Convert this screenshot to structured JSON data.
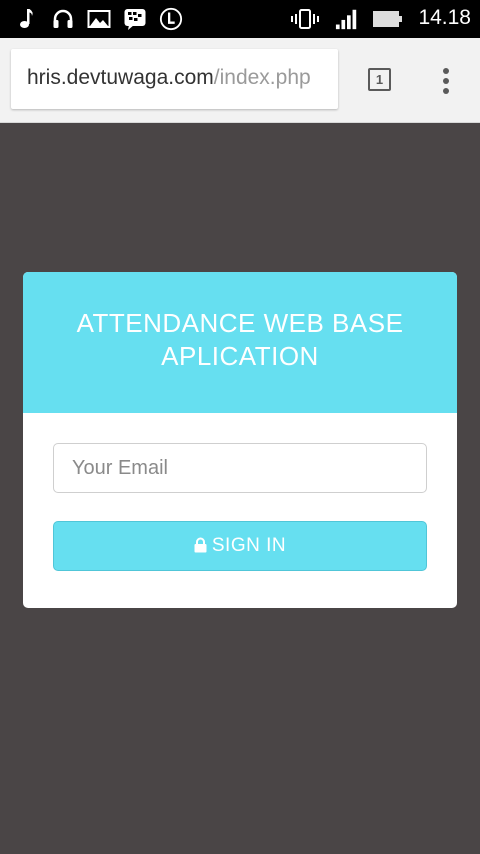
{
  "status_bar": {
    "time": "14.18",
    "icons": [
      "music-note-icon",
      "headset-icon",
      "image-icon",
      "bbm-icon",
      "download-icon",
      "vibrate-icon",
      "signal-icon",
      "battery-icon"
    ]
  },
  "browser": {
    "url_host": "hris.devtuwaga.com",
    "url_path": "/index.php",
    "tab_count": "1"
  },
  "login": {
    "title": "ATTENDANCE WEB BASE APLICATION",
    "email_placeholder": "Your Email",
    "signin_label": "SIGN IN"
  },
  "colors": {
    "background": "#4a4546",
    "accent": "#66dff0",
    "card": "#ffffff"
  }
}
